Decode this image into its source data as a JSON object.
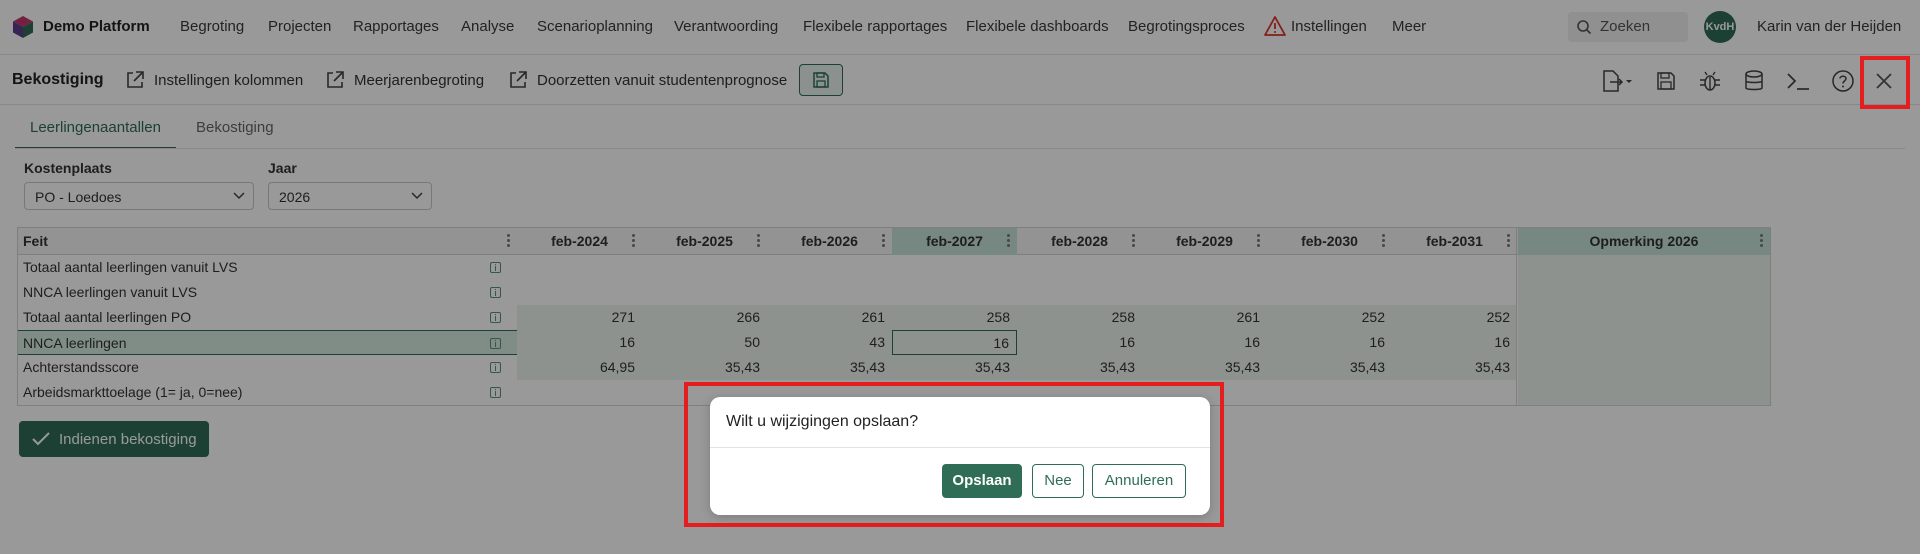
{
  "nav": {
    "brand": "Demo Platform",
    "items": [
      "Begroting",
      "Projecten",
      "Rapportages",
      "Analyse",
      "Scenarioplanning",
      "Verantwoording",
      "Flexibele rapportages",
      "Flexibele dashboards",
      "Begrotingsproces",
      "Instellingen",
      "Meer"
    ],
    "search_placeholder": "Zoeken",
    "avatar_initials": "KvdH",
    "user_name": "Karin van der Heijden",
    "warning_icon": "warning-triangle-icon"
  },
  "toolbar": {
    "title": "Bekostiging",
    "actions": [
      "Instellingen kolommen",
      "Meerjarenbegroting",
      "Doorzetten vanuit studentenprognose"
    ],
    "action_icon": "external-link-icon",
    "right_icons": [
      "export-icon",
      "save-icon",
      "bug-icon",
      "database-icon",
      "terminal-icon",
      "help-icon",
      "close-icon"
    ]
  },
  "tabs": [
    "Leerlingenaantallen",
    "Bekostiging"
  ],
  "active_tab": "Leerlingenaantallen",
  "filters": {
    "kostenplaats": {
      "label": "Kostenplaats",
      "value": "PO - Loedoes"
    },
    "jaar": {
      "label": "Jaar",
      "value": "2026"
    }
  },
  "grid": {
    "first_column": "Feit",
    "columns": [
      "feb-2024",
      "feb-2025",
      "feb-2026",
      "feb-2027",
      "feb-2028",
      "feb-2029",
      "feb-2030",
      "feb-2031"
    ],
    "remark_column": "Opmerking 2026",
    "highlighted_column": "feb-2027",
    "rows": [
      {
        "label": "Totaal aantal leerlingen vanuit LVS",
        "values": [
          "",
          "",
          "",
          "",
          "",
          "",
          "",
          ""
        ]
      },
      {
        "label": "NNCA leerlingen vanuit LVS",
        "values": [
          "",
          "",
          "",
          "",
          "",
          "",
          "",
          ""
        ]
      },
      {
        "label": "Totaal aantal leerlingen PO",
        "values": [
          "271",
          "266",
          "261",
          "258",
          "258",
          "261",
          "252",
          "252"
        ]
      },
      {
        "label": "NNCA leerlingen",
        "values": [
          "16",
          "50",
          "43",
          "16",
          "16",
          "16",
          "16",
          "16"
        ]
      },
      {
        "label": "Achterstandsscore",
        "values": [
          "64,95",
          "35,43",
          "35,43",
          "35,43",
          "35,43",
          "35,43",
          "35,43",
          "35,43"
        ]
      },
      {
        "label": "Arbeidsmarkttoelage (1= ja, 0=nee)",
        "values": [
          "",
          "",
          "",
          "",
          "",
          "",
          "",
          ""
        ]
      }
    ]
  },
  "submit_label": "Indienen bekostiging",
  "dialog": {
    "title": "Wilt u wijzigingen opslaan?",
    "buttons": {
      "save": "Opslaan",
      "no": "Nee",
      "cancel": "Annuleren"
    }
  },
  "colors": {
    "accent": "#2f6d57",
    "highlight": "#e41e1e"
  }
}
